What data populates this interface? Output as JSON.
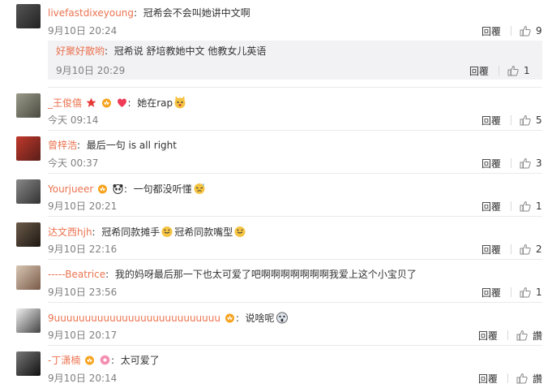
{
  "actions": {
    "reply_label": "回覆",
    "like_label_none": "讚"
  },
  "comments": [
    {
      "user": "livefastdixeyoung",
      "sep": ":",
      "text": "冠希会不会叫她讲中文啊",
      "time": "9月10日 20:24",
      "likes": "9"
    },
    {
      "user": "_王俊僖",
      "sep": ":",
      "text": "她在rap",
      "time": "今天 09:14",
      "likes": "5"
    },
    {
      "user": "曾梓浩",
      "sep": ":",
      "text": "最后一句 is all right",
      "time": "今天 00:37",
      "likes": "3"
    },
    {
      "user": "Yourjueer",
      "sep": ":",
      "text": "一句都没听懂",
      "time": "9月10日 20:21",
      "likes": "1"
    },
    {
      "user": "达文西hjh",
      "sep": ":",
      "text": "冠希同款摊手",
      "text2": "冠希同款嘴型",
      "time": "9月10日 22:16",
      "likes": "2"
    },
    {
      "user": "-----Beatrice",
      "sep": ":",
      "text": "我的妈呀最后那一下也太可爱了吧啊啊啊啊啊啊啊我爱上这个小宝贝了",
      "time": "9月10日 23:56",
      "likes": "1"
    },
    {
      "user": "9uuuuuuuuuuuuuuuuuuuuuuuuuuu",
      "sep": ":",
      "text": "说啥呢",
      "time": "9月10日 20:17",
      "likes": ""
    },
    {
      "user": "-丁潇楠",
      "sep": ":",
      "text": "太可爱了",
      "time": "9月10日 20:14",
      "likes": ""
    }
  ],
  "subreply": {
    "user": "好聚好散哟",
    "sep": ":",
    "text": "冠希说 舒培教她中文 他教女儿英语",
    "time": "9月10日 20:29",
    "likes": "1"
  },
  "colors": {
    "username": "#eb7350",
    "meta": "#808080",
    "subreply_bg": "#f2f2f5"
  }
}
